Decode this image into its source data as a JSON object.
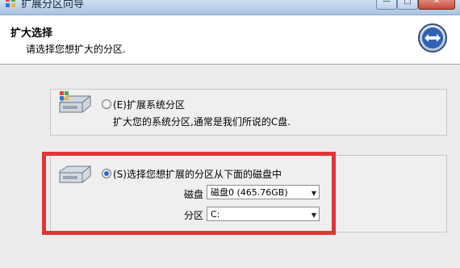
{
  "window": {
    "title": "扩展分区向导",
    "minimize_glyph": "—",
    "maximize_glyph": "□",
    "close_glyph": "✕"
  },
  "header": {
    "title": "扩大选择",
    "subtitle": "请选择您想扩大的分区."
  },
  "options": [
    {
      "label": "(E)扩展系统分区",
      "description": "扩大您的系统分区,通常是我们所说的C盘.",
      "selected": false
    },
    {
      "label": "(S)选择您想扩展的分区从下面的磁盘中",
      "selected": true,
      "fields": {
        "disk_label": "磁盘",
        "disk_value": "磁盘0 (465.76GB)",
        "partition_label": "分区",
        "partition_value": "C:"
      }
    }
  ],
  "colors": {
    "highlight": "#e0363a",
    "radio_selected": "#2b6fbf",
    "title_bar": "#bcd0ea"
  }
}
